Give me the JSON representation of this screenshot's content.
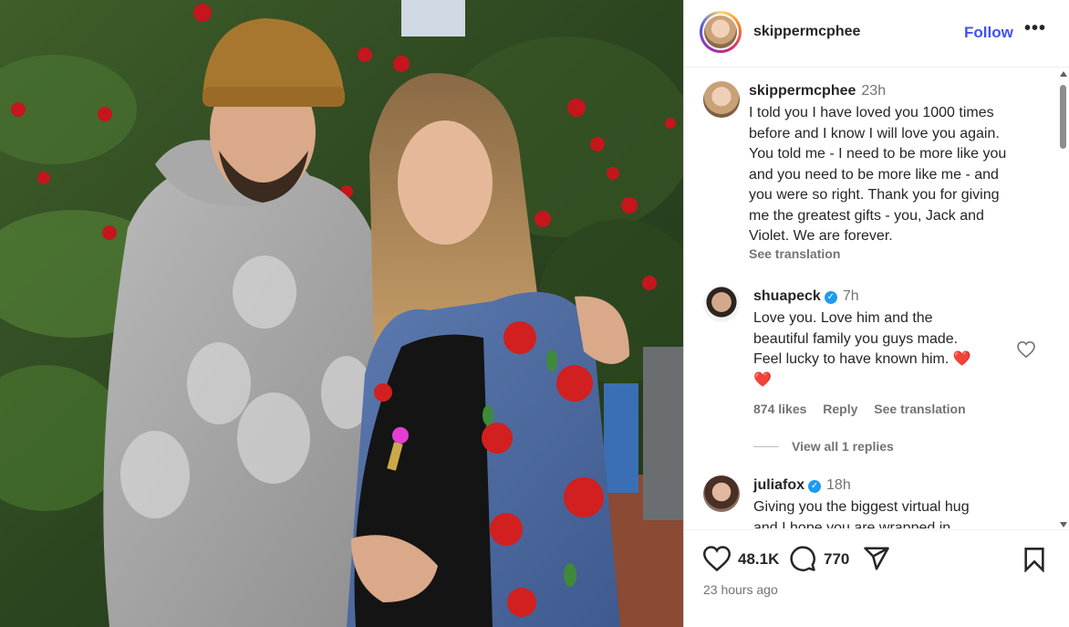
{
  "post": {
    "username": "skippermcphee",
    "follow_label": "Follow",
    "more_label": "•••"
  },
  "caption": {
    "username": "skippermcphee",
    "time": "23h",
    "text_lines": [
      "I told you I have loved you 1000 times",
      "before and I know I will love you again.",
      "You told me - I need to be more like you",
      "and you need to be more like me - and",
      "you were so right.  Thank you for giving",
      "me the greatest gifts -  you, Jack and",
      "Violet. We are forever."
    ],
    "see_translation": "See translation"
  },
  "comments": [
    {
      "username": "shuapeck",
      "verified": true,
      "time": "7h",
      "text_lines": [
        "Love you. Love him and the",
        "beautiful family you guys made.",
        "Feel lucky to have known him. ❤️",
        "❤️"
      ],
      "likes": "874 likes",
      "reply_label": "Reply",
      "see_translation": "See translation",
      "view_replies": "View all 1 replies"
    },
    {
      "username": "juliafox",
      "verified": true,
      "time": "18h",
      "text_lines": [
        "Giving you the biggest virtual hug",
        "and I hope you are wrapped in"
      ]
    }
  ],
  "actions": {
    "like_count": "48.1K",
    "comment_count": "770",
    "timestamp": "23 hours ago"
  },
  "colors": {
    "follow": "#4150f7",
    "verified": "#1d9bf0",
    "heart_emoji": "#f0386b"
  }
}
